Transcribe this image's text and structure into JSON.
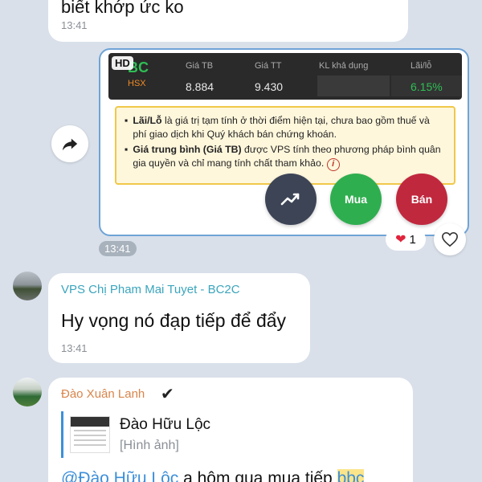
{
  "top_message": {
    "text": "biết khớp ức ko",
    "time": "13:41"
  },
  "image_message": {
    "hd_badge": "HD",
    "stock": {
      "symbol": "BC",
      "exchange": "HSX",
      "headers": [
        "Giá TB",
        "Giá TT",
        "KL khả dụng",
        "Lãi/lỗ"
      ],
      "avg_price": "8.884",
      "current_price": "9.430",
      "pnl_pct": "6.15%"
    },
    "note": {
      "b1_bold": "Lãi/Lỗ",
      "b1_text": " là giá trị tạm tính ở thời điểm hiện tại, chưa bao gồm thuế và phí giao dịch khi Quý khách bán chứng khoán.",
      "b2_bold": "Giá trung bình (Giá TB)",
      "b2_text": " được VPS tính theo phương pháp bình quân gia quyền và chỉ mang tính chất tham khảo.",
      "info_glyph": "i"
    },
    "buttons": {
      "buy": "Mua",
      "sell": "Bán"
    },
    "time": "13:41",
    "reaction_count": "1"
  },
  "message_vps": {
    "sender": "VPS Chị Pham Mai Tuyet - BC2C",
    "text": "Hy vọng nó đạp tiếp để đẩy",
    "time": "13:41"
  },
  "message_dao": {
    "sender": "Đào Xuân Lanh",
    "verified_glyph": "✔",
    "reply_name": "Đào Hữu Lộc",
    "reply_sub": "[Hình ảnh]",
    "mention": "@Đào Hữu Lộc",
    "text_rest": " a hôm qua mua tiếp ",
    "highlight": "bbc"
  },
  "colors": {
    "background": "#d9e0ea",
    "accent": "#3d8fd9",
    "buy": "#2fae4f",
    "sell": "#c0283e"
  }
}
